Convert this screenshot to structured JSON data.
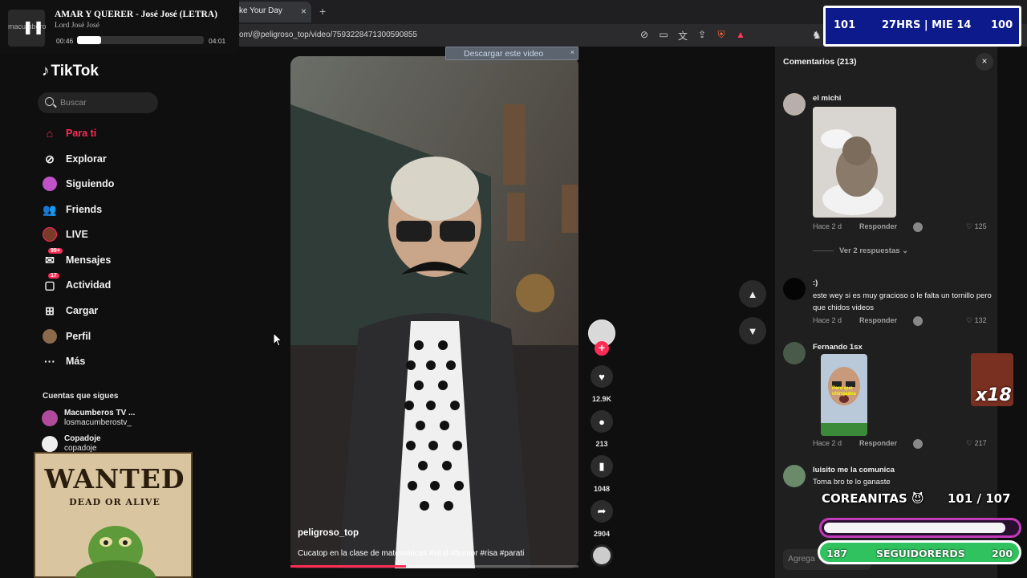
{
  "browser": {
    "tab_title": "ke Your Day",
    "tab_close": "×",
    "new_tab": "+",
    "url": "om/@peligroso_top/video/7593228471300590855",
    "icons": [
      "eye-off-icon",
      "cast-icon",
      "translate-icon",
      "share-icon",
      "brave-shields-icon",
      "brave-rewards-icon"
    ]
  },
  "media_player": {
    "art_label": "macumbero",
    "title": "AMAR Y QUERER - José José (LETRA)",
    "artist": "Lord José José",
    "current_time": "00:46",
    "total_time": "04:01",
    "progress": 0.19,
    "play_state_icon": "❚❚"
  },
  "score_widget": {
    "left": "101",
    "middle": "27HRS | MIE 14",
    "right": "100",
    "color": "#0c1a8c"
  },
  "sidebar": {
    "brand": "TikTok",
    "search_placeholder": "Buscar",
    "items": [
      {
        "label": "Para ti",
        "icon": "home-icon",
        "active": true
      },
      {
        "label": "Explorar",
        "icon": "compass-icon"
      },
      {
        "label": "Siguiendo",
        "icon": "following-avatar-icon"
      },
      {
        "label": "Friends",
        "icon": "friends-icon"
      },
      {
        "label": "LIVE",
        "icon": "live-avatar-icon"
      },
      {
        "label": "Mensajes",
        "icon": "messages-icon",
        "badge": "99+"
      },
      {
        "label": "Actividad",
        "icon": "activity-icon",
        "badge": "17"
      },
      {
        "label": "Cargar",
        "icon": "upload-icon"
      },
      {
        "label": "Perfil",
        "icon": "profile-avatar-icon"
      },
      {
        "label": "Más",
        "icon": "more-icon"
      }
    ],
    "following_title": "Cuentas que sigues",
    "accounts": [
      {
        "name": "Macumberos TV ...",
        "handle": "losmacumberostv_"
      },
      {
        "name": "Copadoje",
        "handle": "copadoje"
      }
    ]
  },
  "wanted_poster": {
    "title": "WANTED",
    "subtitle": "DEAD OR ALIVE"
  },
  "video": {
    "download_label": "Descargar este video",
    "download_close": "×",
    "author": "peligroso_top",
    "caption": "Cucatop en la clase de matemáticas #viral #humor #risa #parati",
    "progress": 0.4,
    "likes": "12.9K",
    "comments": "213",
    "saves": "1048",
    "shares": "2904",
    "follow_label": "+",
    "accent": "#fe2c55"
  },
  "comments": {
    "title": "Comentarios (213)",
    "close": "×",
    "reply_label": "Responder",
    "items": [
      {
        "user": "el michi",
        "text": "",
        "time": "Hace 2 d",
        "likes": "125"
      },
      {
        "user": ":)",
        "text": "este wey si es muy gracioso o le falta un tornillo pero que chidos videos",
        "time": "Hace 2 d",
        "likes": "132"
      },
      {
        "user": "Fernando 1sx",
        "text": "",
        "time": "Hace 2 d",
        "likes": "217"
      },
      {
        "user": "luisito me la comunica",
        "text": "Toma bro te lo ganaste",
        "time": "",
        "likes": ""
      }
    ],
    "more_replies": "Ver 2 respuestas",
    "sticker_text": "Pero que chingados",
    "add_placeholder": "Agrega"
  },
  "stream_overlay": {
    "coreanitas_label": "COREANITAS",
    "coreanitas_emoji": "😈",
    "coreanitas_count": "101 / 107",
    "coreanitas_progress": 0.94,
    "followers_left": "187",
    "followers_label": "SEGUIDORERDS",
    "followers_right": "200",
    "multiplier": "x18"
  }
}
